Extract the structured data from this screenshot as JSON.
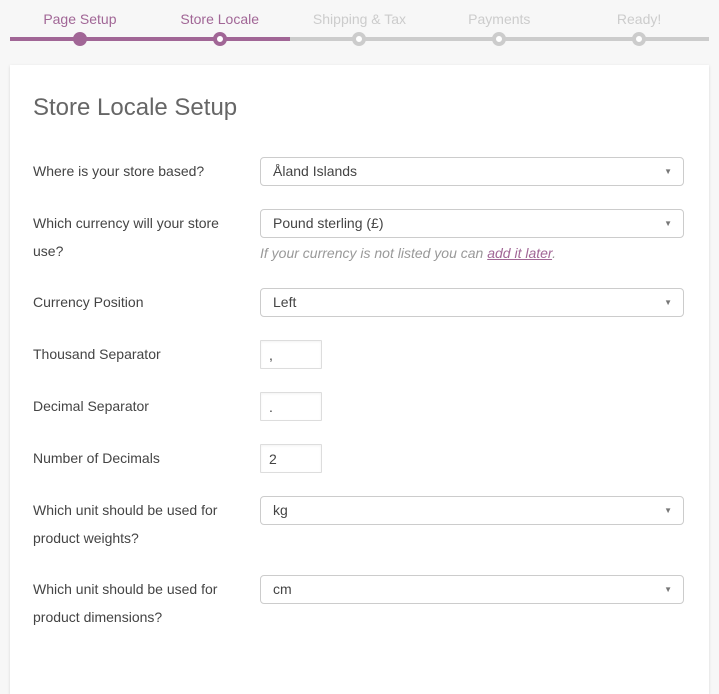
{
  "stepper": {
    "accent_color": "#a16696",
    "inactive_color": "#cccccc",
    "steps": [
      {
        "label": "Page Setup",
        "state": "done"
      },
      {
        "label": "Store Locale",
        "state": "active"
      },
      {
        "label": "Shipping & Tax",
        "state": "upcoming"
      },
      {
        "label": "Payments",
        "state": "upcoming"
      },
      {
        "label": "Ready!",
        "state": "upcoming"
      }
    ]
  },
  "page": {
    "title": "Store Locale Setup"
  },
  "form": {
    "fields": [
      {
        "id": "store-location",
        "label": "Where is your store based?",
        "type": "select",
        "value": "Åland Islands"
      },
      {
        "id": "currency",
        "label": "Which currency will your store use?",
        "type": "select",
        "value": "Pound sterling (£)",
        "help_prefix": "If your currency is not listed you can ",
        "help_link": "add it later",
        "help_suffix": "."
      },
      {
        "id": "currency-position",
        "label": "Currency Position",
        "type": "select",
        "value": "Left"
      },
      {
        "id": "thousand-separator",
        "label": "Thousand Separator",
        "type": "text",
        "value": ","
      },
      {
        "id": "decimal-separator",
        "label": "Decimal Separator",
        "type": "text",
        "value": "."
      },
      {
        "id": "number-of-decimals",
        "label": "Number of Decimals",
        "type": "text",
        "value": "2"
      },
      {
        "id": "weight-unit",
        "label": "Which unit should be used for product weights?",
        "type": "select",
        "value": "kg"
      },
      {
        "id": "dimension-unit",
        "label": "Which unit should be used for product dimensions?",
        "type": "select",
        "value": "cm"
      }
    ]
  },
  "icons": {
    "chevron_down": "▼"
  }
}
